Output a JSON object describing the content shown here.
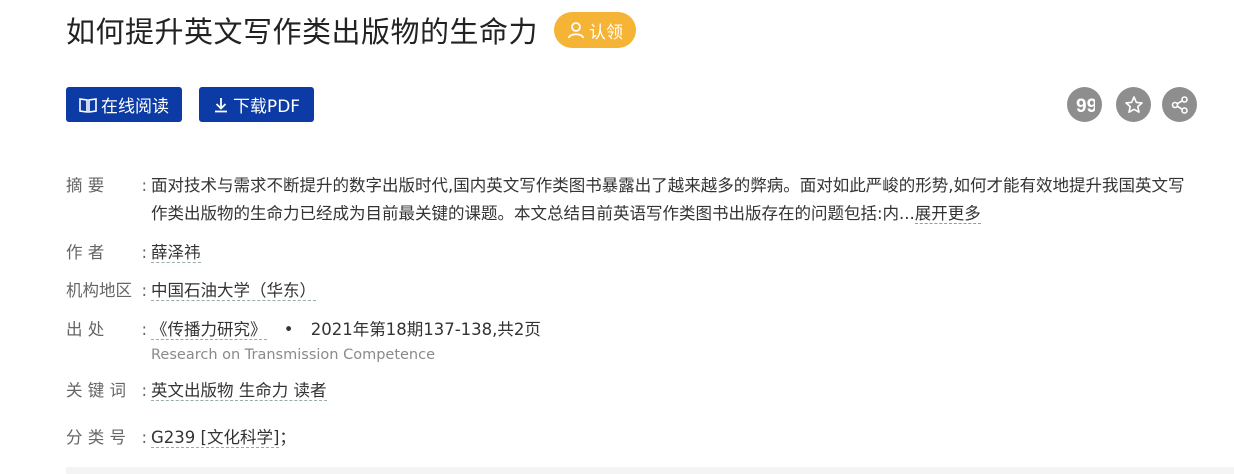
{
  "title": "如何提升英文写作类出版物的生命力",
  "claim_label": "认领",
  "buttons": {
    "read_online": "在线阅读",
    "download_pdf": "下载PDF"
  },
  "icons": {
    "cite": "quote-icon",
    "favorite": "star-icon",
    "share": "share-icon"
  },
  "meta": {
    "abstract_label": "摘 要",
    "abstract_text": "面对技术与需求不断提升的数字出版时代,国内英文写作类图书暴露出了越来越多的弊病。面对如此严峻的形势,如何才能有效地提升我国英文写作类出版物的生命力已经成为目前最关键的课题。本文总结目前英语写作类图书出版存在的问题包括:内...",
    "expand_label": "展开更多",
    "author_label": "作 者",
    "author": "薛泽祎",
    "org_label": "机构地区",
    "org": "中国石油大学（华东）",
    "source_label": "出 处",
    "journal": "《传播力研究》",
    "issue": "2021年第18期137-138,共2页",
    "journal_en": "Research on Transmission Competence",
    "keywords_label": "关 键 词",
    "keywords": "英文出版物 生命力 读者",
    "class_label": "分 类 号",
    "class_code": "G239 [文化科学]",
    "class_sep": "；"
  },
  "colors": {
    "primary": "#0d3ba5",
    "claim": "#f5b436",
    "icon_circle": "#8e8e8e"
  }
}
